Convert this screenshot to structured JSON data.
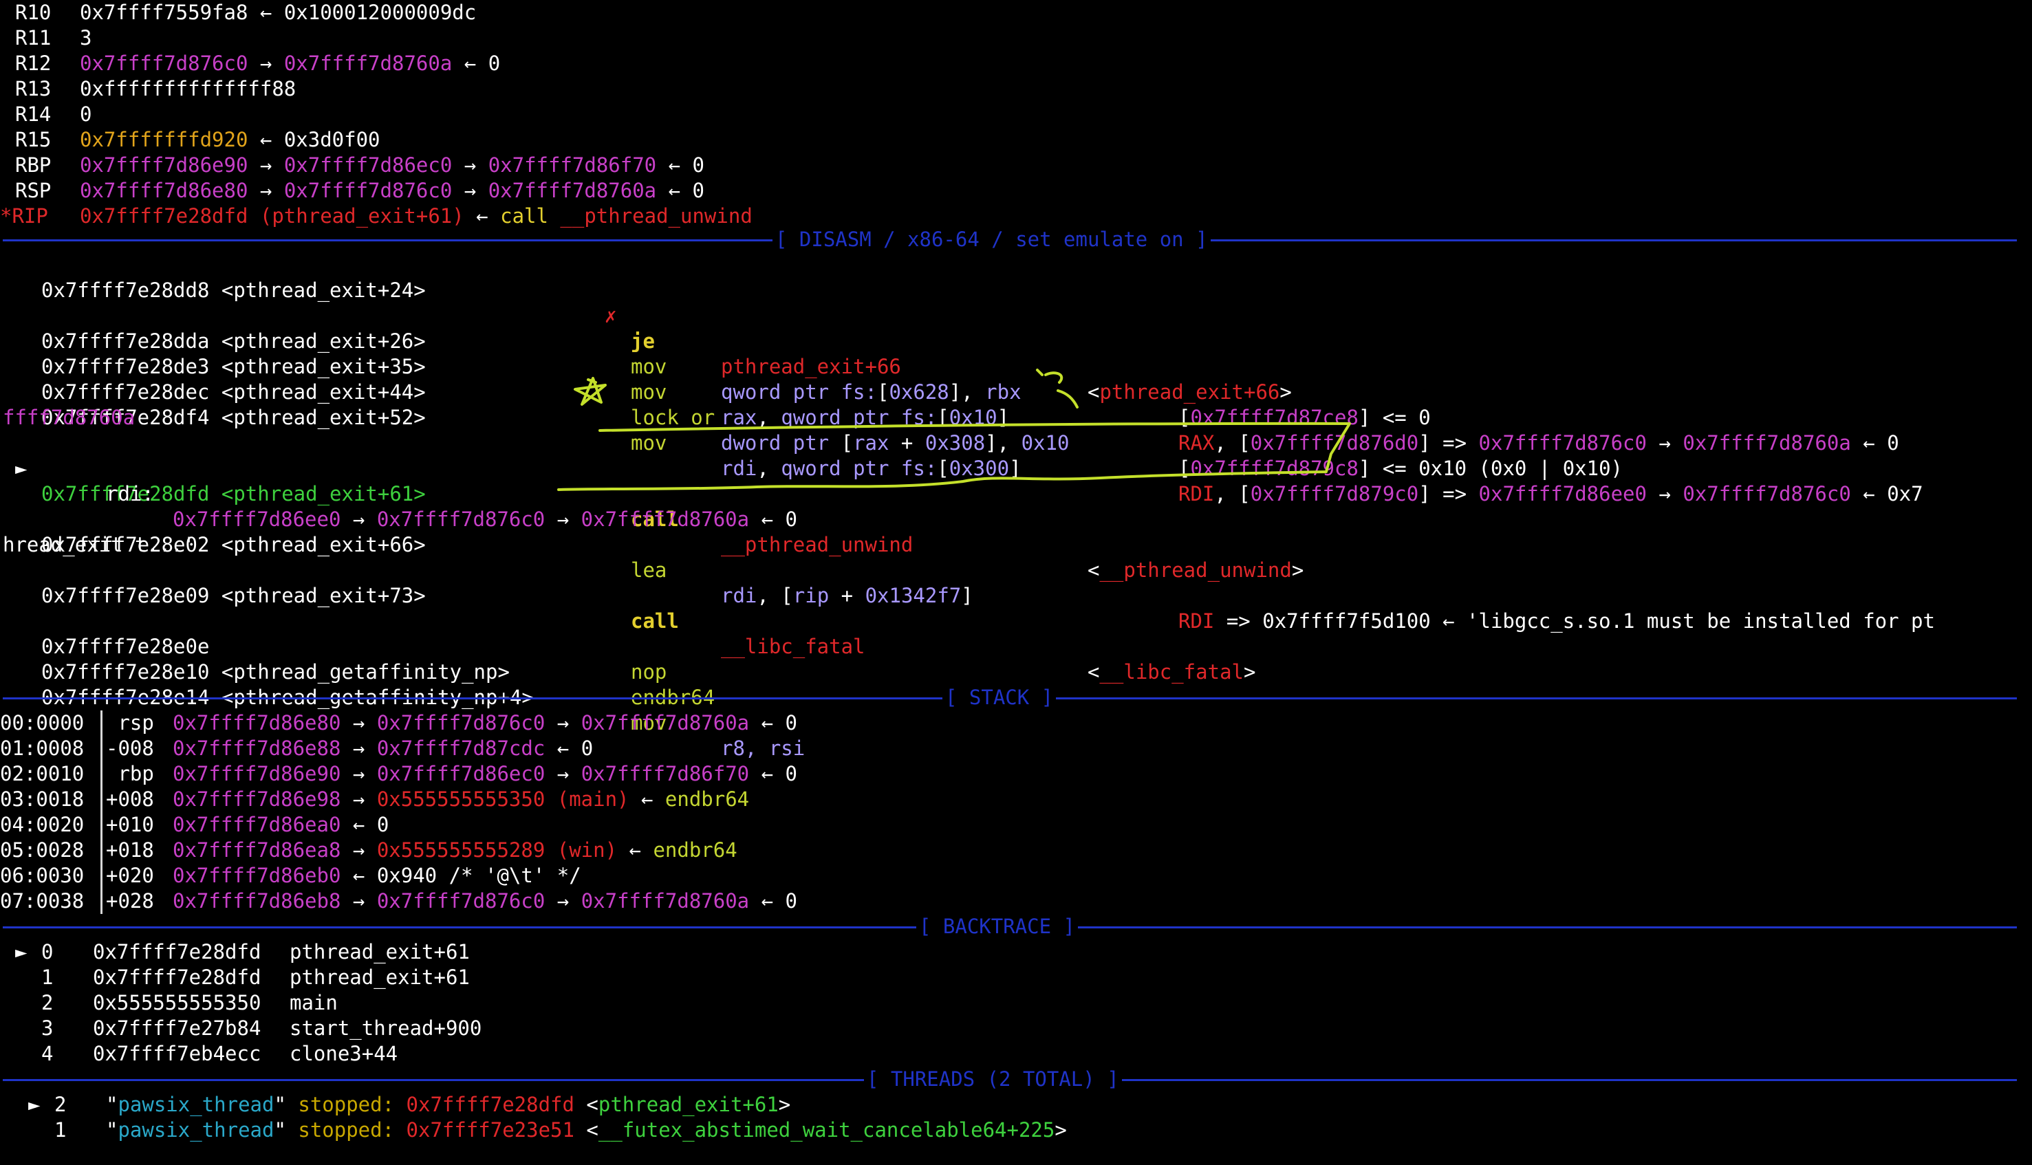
{
  "registers": [
    {
      "name": "R10",
      "val": "0x7ffff7559fa8",
      "rest": [
        [
          "arrow",
          "←"
        ],
        [
          "w",
          "0x100012000009dc"
        ]
      ]
    },
    {
      "name": "R11",
      "val": "3",
      "rest": []
    },
    {
      "name": "R12",
      "val": "0x7ffff7d876c0",
      "rest": [
        [
          "arrow",
          "→"
        ],
        [
          "p",
          "0x7ffff7d8760a"
        ],
        [
          "arrow",
          "←"
        ],
        [
          "w",
          "0"
        ]
      ],
      "valColor": "p"
    },
    {
      "name": "R13",
      "val": "0xffffffffffffff88",
      "rest": []
    },
    {
      "name": "R14",
      "val": "0",
      "rest": []
    },
    {
      "name": "R15",
      "val": "0x7fffffffd920",
      "rest": [
        [
          "arrow",
          "←"
        ],
        [
          "w",
          "0x3d0f00"
        ]
      ],
      "valColor": "o"
    },
    {
      "name": "RBP",
      "val": "0x7ffff7d86e90",
      "rest": [
        [
          "arrow",
          "→"
        ],
        [
          "p",
          "0x7ffff7d86ec0"
        ],
        [
          "arrow",
          "→"
        ],
        [
          "p",
          "0x7ffff7d86f70"
        ],
        [
          "arrow",
          "←"
        ],
        [
          "w",
          "0"
        ]
      ],
      "valColor": "p"
    },
    {
      "name": "RSP",
      "val": "0x7ffff7d86e80",
      "rest": [
        [
          "arrow",
          "→"
        ],
        [
          "p",
          "0x7ffff7d876c0"
        ],
        [
          "arrow",
          "→"
        ],
        [
          "p",
          "0x7ffff7d8760a"
        ],
        [
          "arrow",
          "←"
        ],
        [
          "w",
          "0"
        ]
      ],
      "valColor": "p"
    },
    {
      "name": "*RIP",
      "val": "0x7ffff7e28dfd (pthread_exit+61)",
      "rest": [
        [
          "arrow",
          "←"
        ],
        [
          "y",
          "call"
        ],
        [
          "r",
          "__pthread_unwind"
        ]
      ],
      "valColor": "r",
      "nameColor": "r"
    }
  ],
  "sections": {
    "disasm": "[ DISASM / x86-64 / set emulate on ]",
    "stack": "[ STACK ]",
    "backtrace": "[ BACKTRACE ]",
    "threads": "[ THREADS (2 TOTAL) ]"
  },
  "disasm": {
    "l0": {
      "addr": "0x7ffff7e28dd8 <pthread_exit+24>",
      "mark": "✗",
      "op": "je",
      "args": "pthread_exit+66",
      "comment": "<pthread_exit+66>"
    },
    "l1": {
      "addr": "0x7ffff7e28dda <pthread_exit+26>",
      "op": "mov",
      "args": "qword ptr fs:[0x628], rbx",
      "c1": "[",
      "c2": "0x7ffff7d87ce8",
      "c3": "] <= 0"
    },
    "l2": {
      "addr": "0x7ffff7e28de3 <pthread_exit+35>",
      "op": "mov",
      "args": "rax, qword ptr fs:[0x10]",
      "c1": "RAX",
      "c2": ", [",
      "c3": "0x7ffff7d876d0",
      "c4": "] => ",
      "c5": "0x7ffff7d876c0",
      "c6": "→",
      "c7": "0x7ffff7d8760a",
      "c8": "← 0"
    },
    "l3": {
      "addr": "0x7ffff7e28dec <pthread_exit+44>",
      "op": "lock or",
      "args": "dword ptr [rax + 0x308], 0x10",
      "c1": "[",
      "c2": "0x7ffff7d879c8",
      "c3": "] <= 0x10 (0x0 | 0x10)"
    },
    "l4": {
      "addr": "0x7ffff7e28df4 <pthread_exit+52>",
      "op": "mov",
      "args": "rdi, qword ptr fs:[0x300]",
      "c1": "RDI",
      "c2": ", [",
      "c3": "0x7ffff7d879c0",
      "c4": "] => ",
      "c5": "0x7ffff7d86ee0",
      "c6": "→",
      "c7": "0x7ffff7d876c0",
      "c8": "← 0x7"
    },
    "l4wrap": "ffff7d8760a",
    "l5": {
      "marker": "►",
      "addr": "0x7ffff7e28dfd <pthread_exit+61>",
      "op": "call",
      "args": "__pthread_unwind",
      "comment": "<__pthread_unwind>"
    },
    "l5arg": {
      "name": "rdi:",
      "v1": "0x7ffff7d86ee0",
      "v2": "0x7ffff7d876c0",
      "v3": "0x7ffff7d8760a",
      "tail": "← 0"
    },
    "l6": {
      "addr": "0x7ffff7e28e02 <pthread_exit+66>",
      "op": "lea",
      "args": "rdi, [rip + 0x1342f7]",
      "c1": "RDI",
      "c2": " => 0x7ffff7f5d100 ← 'libgcc_s.so.1 must be installed for pt"
    },
    "l6wrap": "hread_exit t...'",
    "l7": {
      "addr": "0x7ffff7e28e09 <pthread_exit+73>",
      "op": "call",
      "args": "__libc_fatal",
      "comment": "<__libc_fatal>"
    },
    "l8": {
      "addr": "0x7ffff7e28e0e",
      "op": "nop"
    },
    "l9": {
      "addr": "0x7ffff7e28e10 <pthread_getaffinity_np>",
      "op": "endbr64"
    },
    "l10": {
      "addr": "0x7ffff7e28e14 <pthread_getaffinity_np+4>",
      "op": "mov",
      "args": "r8, rsi"
    }
  },
  "stack": [
    {
      "idx": "00:0000",
      "off": " rsp",
      "addr": "0x7ffff7d86e80",
      "chain": [
        [
          "a",
          "→"
        ],
        [
          "p",
          "0x7ffff7d876c0"
        ],
        [
          "a",
          "→"
        ],
        [
          "p",
          "0x7ffff7d8760a"
        ],
        [
          "a",
          "←"
        ],
        [
          "w",
          "0"
        ]
      ]
    },
    {
      "idx": "01:0008",
      "off": "-008",
      "addr": "0x7ffff7d86e88",
      "chain": [
        [
          "a",
          "→"
        ],
        [
          "p",
          "0x7ffff7d87cdc"
        ],
        [
          "a",
          "←"
        ],
        [
          "w",
          "0"
        ]
      ]
    },
    {
      "idx": "02:0010",
      "off": " rbp",
      "addr": "0x7ffff7d86e90",
      "chain": [
        [
          "a",
          "→"
        ],
        [
          "p",
          "0x7ffff7d86ec0"
        ],
        [
          "a",
          "→"
        ],
        [
          "p",
          "0x7ffff7d86f70"
        ],
        [
          "a",
          "←"
        ],
        [
          "w",
          "0"
        ]
      ]
    },
    {
      "idx": "03:0018",
      "off": "+008",
      "addr": "0x7ffff7d86e98",
      "chain": [
        [
          "a",
          "→"
        ],
        [
          "r",
          "0x555555555350 (main)"
        ],
        [
          "a",
          "←"
        ],
        [
          "lg",
          "endbr64"
        ]
      ]
    },
    {
      "idx": "04:0020",
      "off": "+010",
      "addr": "0x7ffff7d86ea0",
      "chain": [
        [
          "a",
          "←"
        ],
        [
          "w",
          "0"
        ]
      ]
    },
    {
      "idx": "05:0028",
      "off": "+018",
      "addr": "0x7ffff7d86ea8",
      "chain": [
        [
          "a",
          "→"
        ],
        [
          "r",
          "0x555555555289 (win)"
        ],
        [
          "a",
          "←"
        ],
        [
          "lg",
          "endbr64"
        ]
      ]
    },
    {
      "idx": "06:0030",
      "off": "+020",
      "addr": "0x7ffff7d86eb0",
      "chain": [
        [
          "a",
          "←"
        ],
        [
          "w",
          "0x940 /* '@\\t' */"
        ]
      ]
    },
    {
      "idx": "07:0038",
      "off": "+028",
      "addr": "0x7ffff7d86eb8",
      "chain": [
        [
          "a",
          "→"
        ],
        [
          "p",
          "0x7ffff7d876c0"
        ],
        [
          "a",
          "→"
        ],
        [
          "p",
          "0x7ffff7d8760a"
        ],
        [
          "a",
          "←"
        ],
        [
          "w",
          "0"
        ]
      ]
    }
  ],
  "backtrace": [
    {
      "marker": "►",
      "n": "0",
      "addr": "0x7ffff7e28dfd",
      "sym": "pthread_exit+61"
    },
    {
      "marker": " ",
      "n": "1",
      "addr": "0x7ffff7e28dfd",
      "sym": "pthread_exit+61"
    },
    {
      "marker": " ",
      "n": "2",
      "addr": "0x555555555350",
      "sym": "main"
    },
    {
      "marker": " ",
      "n": "3",
      "addr": "0x7ffff7e27b84",
      "sym": "start_thread+900"
    },
    {
      "marker": " ",
      "n": "4",
      "addr": "0x7ffff7eb4ecc",
      "sym": "clone3+44"
    }
  ],
  "threads": [
    {
      "marker": "►",
      "n": "2",
      "name": "pawsix_thread",
      "state": "stopped:",
      "addr": "0x7ffff7e28dfd",
      "loc": "pthread_exit+61"
    },
    {
      "marker": " ",
      "n": "1",
      "name": "pawsix_thread",
      "state": "stopped:",
      "addr": "0x7ffff7e23e51",
      "loc": "__futex_abstimed_wait_cancelable64+225"
    }
  ],
  "colors": {
    "rule": "#1f33c8",
    "annotation": "#c4e02a",
    "purple": "#c840c8",
    "red": "#e0282a",
    "yellow": "#e3cf2e",
    "green": "#3ed13e"
  }
}
